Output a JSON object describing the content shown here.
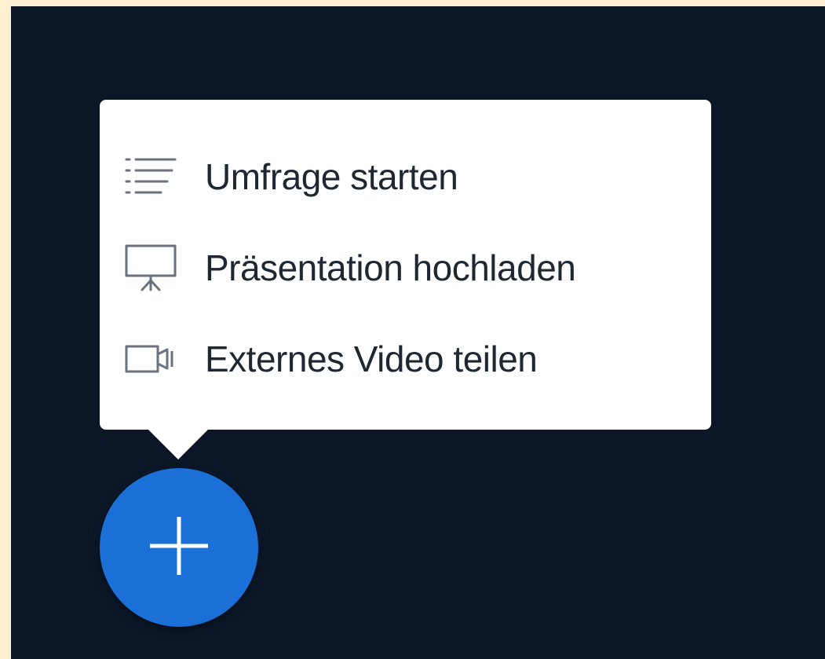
{
  "menu": {
    "items": [
      {
        "label": "Umfrage starten",
        "icon": "poll-list-icon"
      },
      {
        "label": "Präsentation hochladen",
        "icon": "presentation-screen-icon"
      },
      {
        "label": "Externes Video teilen",
        "icon": "video-camera-icon"
      }
    ]
  },
  "fab": {
    "icon": "plus-icon"
  },
  "colors": {
    "background": "#0b1727",
    "menu_background": "#ffffff",
    "fab": "#1a70d6",
    "text": "#1f2733",
    "icon": "#6b7280"
  }
}
